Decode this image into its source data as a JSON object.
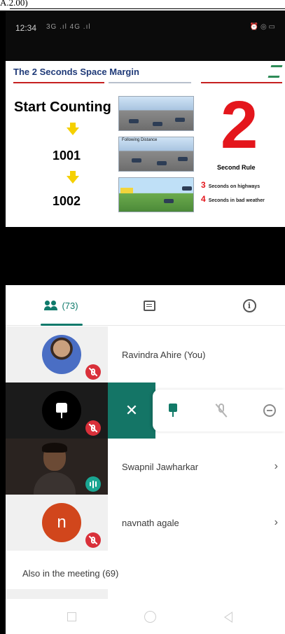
{
  "page_header": {
    "fragment": "A.2.00)"
  },
  "status_bar": {
    "time": "12:34",
    "signal": "3G .ıl 4G .ıl",
    "icons": "alarm wifi battery"
  },
  "slide": {
    "title": "The 2 Seconds Space Margin",
    "start_label": "Start Counting",
    "count_first": "1001",
    "count_second": "1002",
    "big_number": "2",
    "rule_label": "Second Rule",
    "highway_number": "3",
    "highway_text": "Seconds on highways",
    "weather_number": "4",
    "weather_text": "Seconds in bad weather",
    "photo_caption": "Following Distance"
  },
  "tabs": {
    "people_count": "(73)",
    "people_icon": "people-icon",
    "chat_icon": "chat-icon",
    "info_icon": "info-icon"
  },
  "participants": [
    {
      "name": "Ravindra Ahire (You)",
      "muted": true
    },
    {
      "name": "",
      "pinned_tile": true,
      "muted": true
    },
    {
      "name": "Swapnil Jawharkar",
      "speaking": true
    },
    {
      "name": "navnath agale",
      "initial": "n",
      "muted": true
    }
  ],
  "also_in_meeting": "Also in the meeting (69)",
  "colors": {
    "accent": "#147566",
    "mute_red": "#d9303a",
    "avatar_orange": "#d1461c"
  }
}
